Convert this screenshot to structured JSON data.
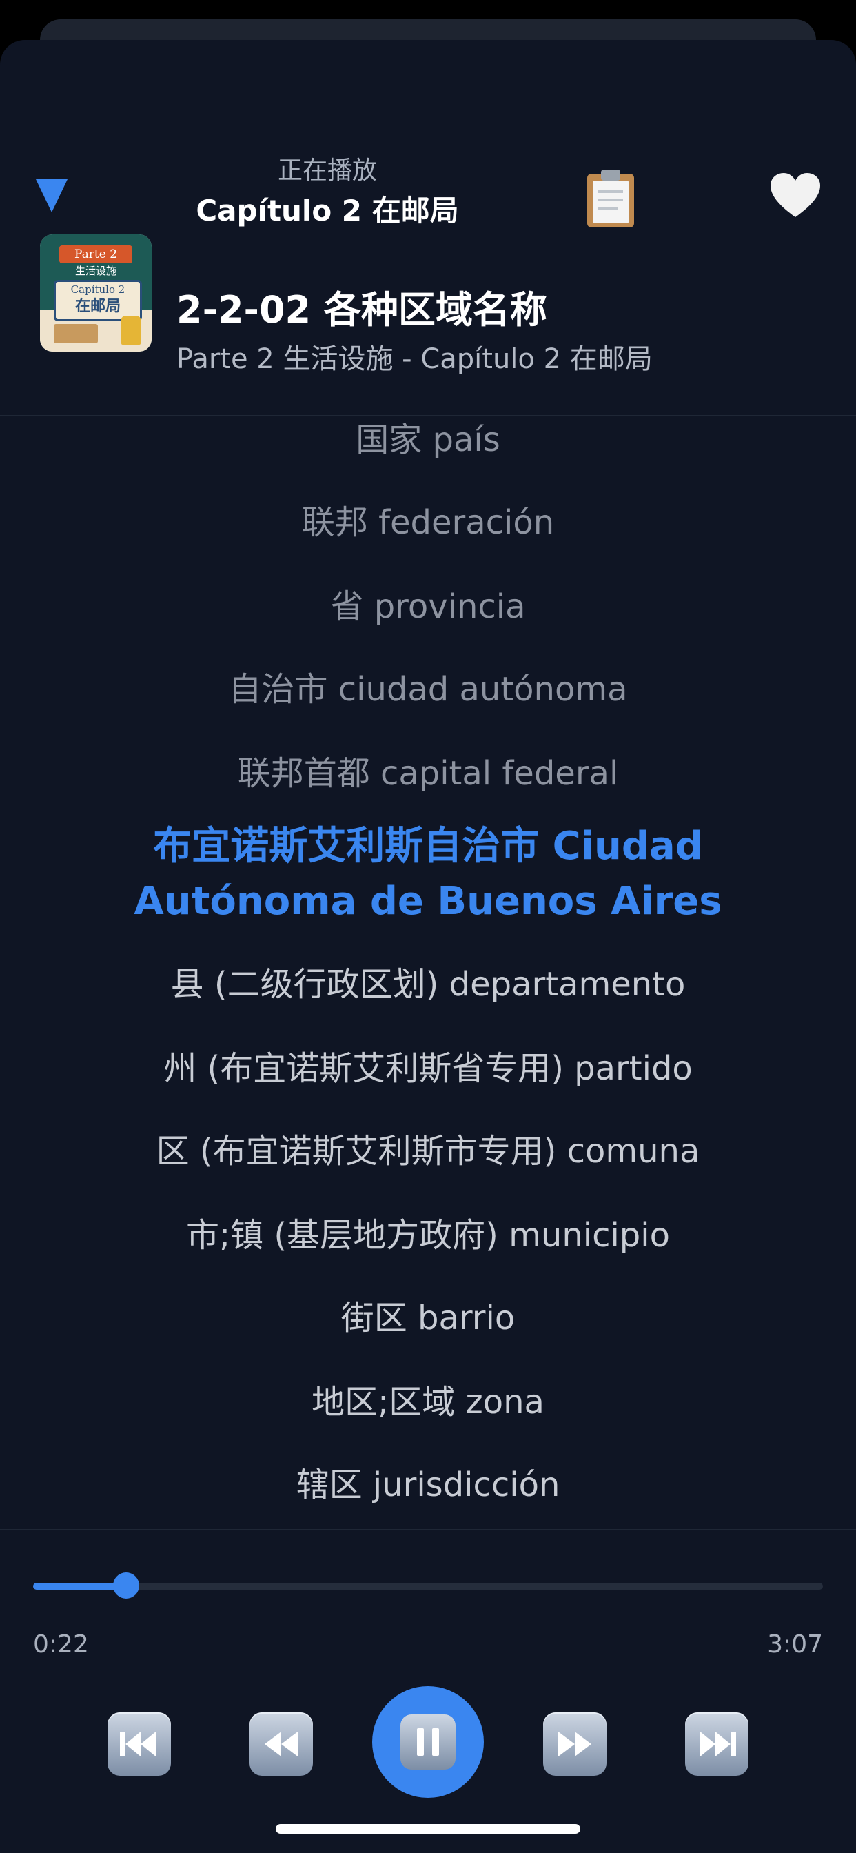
{
  "header": {
    "now_playing_label": "正在播放",
    "chapter_title": "Capítulo 2 在邮局",
    "clipboard_icon": "📋",
    "favorite_icon": "🤍"
  },
  "cover": {
    "parte": "Parte 2",
    "subtitle": "生活设施",
    "capitulo": "Capítulo 2",
    "capitulo_cn": "在邮局"
  },
  "track": {
    "title": "2-2-02 各种区域名称",
    "subtitle": "Parte 2 生活设施 - Capítulo 2 在邮局"
  },
  "lyrics": [
    {
      "text": "国家 país",
      "state": "dim"
    },
    {
      "text": "联邦 federación",
      "state": "dim"
    },
    {
      "text": "省 provincia",
      "state": "dim"
    },
    {
      "text": "自治市 ciudad autónoma",
      "state": "dim"
    },
    {
      "text": "联邦首都 capital federal",
      "state": "dim"
    },
    {
      "text": "布宜诺斯艾利斯自治市 Ciudad Autónoma de Buenos Aires",
      "state": "active"
    },
    {
      "text": "县 (二级行政区划) departamento",
      "state": "mid"
    },
    {
      "text": "州 (布宜诺斯艾利斯省专用) partido",
      "state": "mid"
    },
    {
      "text": "区 (布宜诺斯艾利斯市专用) comuna",
      "state": "mid"
    },
    {
      "text": "市;镇 (基层地方政府) municipio",
      "state": "mid"
    },
    {
      "text": "街区 barrio",
      "state": "mid"
    },
    {
      "text": "地区;区域 zona",
      "state": "mid"
    },
    {
      "text": "辖区 jurisdicción",
      "state": "mid"
    }
  ],
  "playback": {
    "elapsed": "0:22",
    "duration": "3:07",
    "progress_fraction": 0.1176
  },
  "colors": {
    "accent": "#3a86f0",
    "background": "#0f1524"
  }
}
